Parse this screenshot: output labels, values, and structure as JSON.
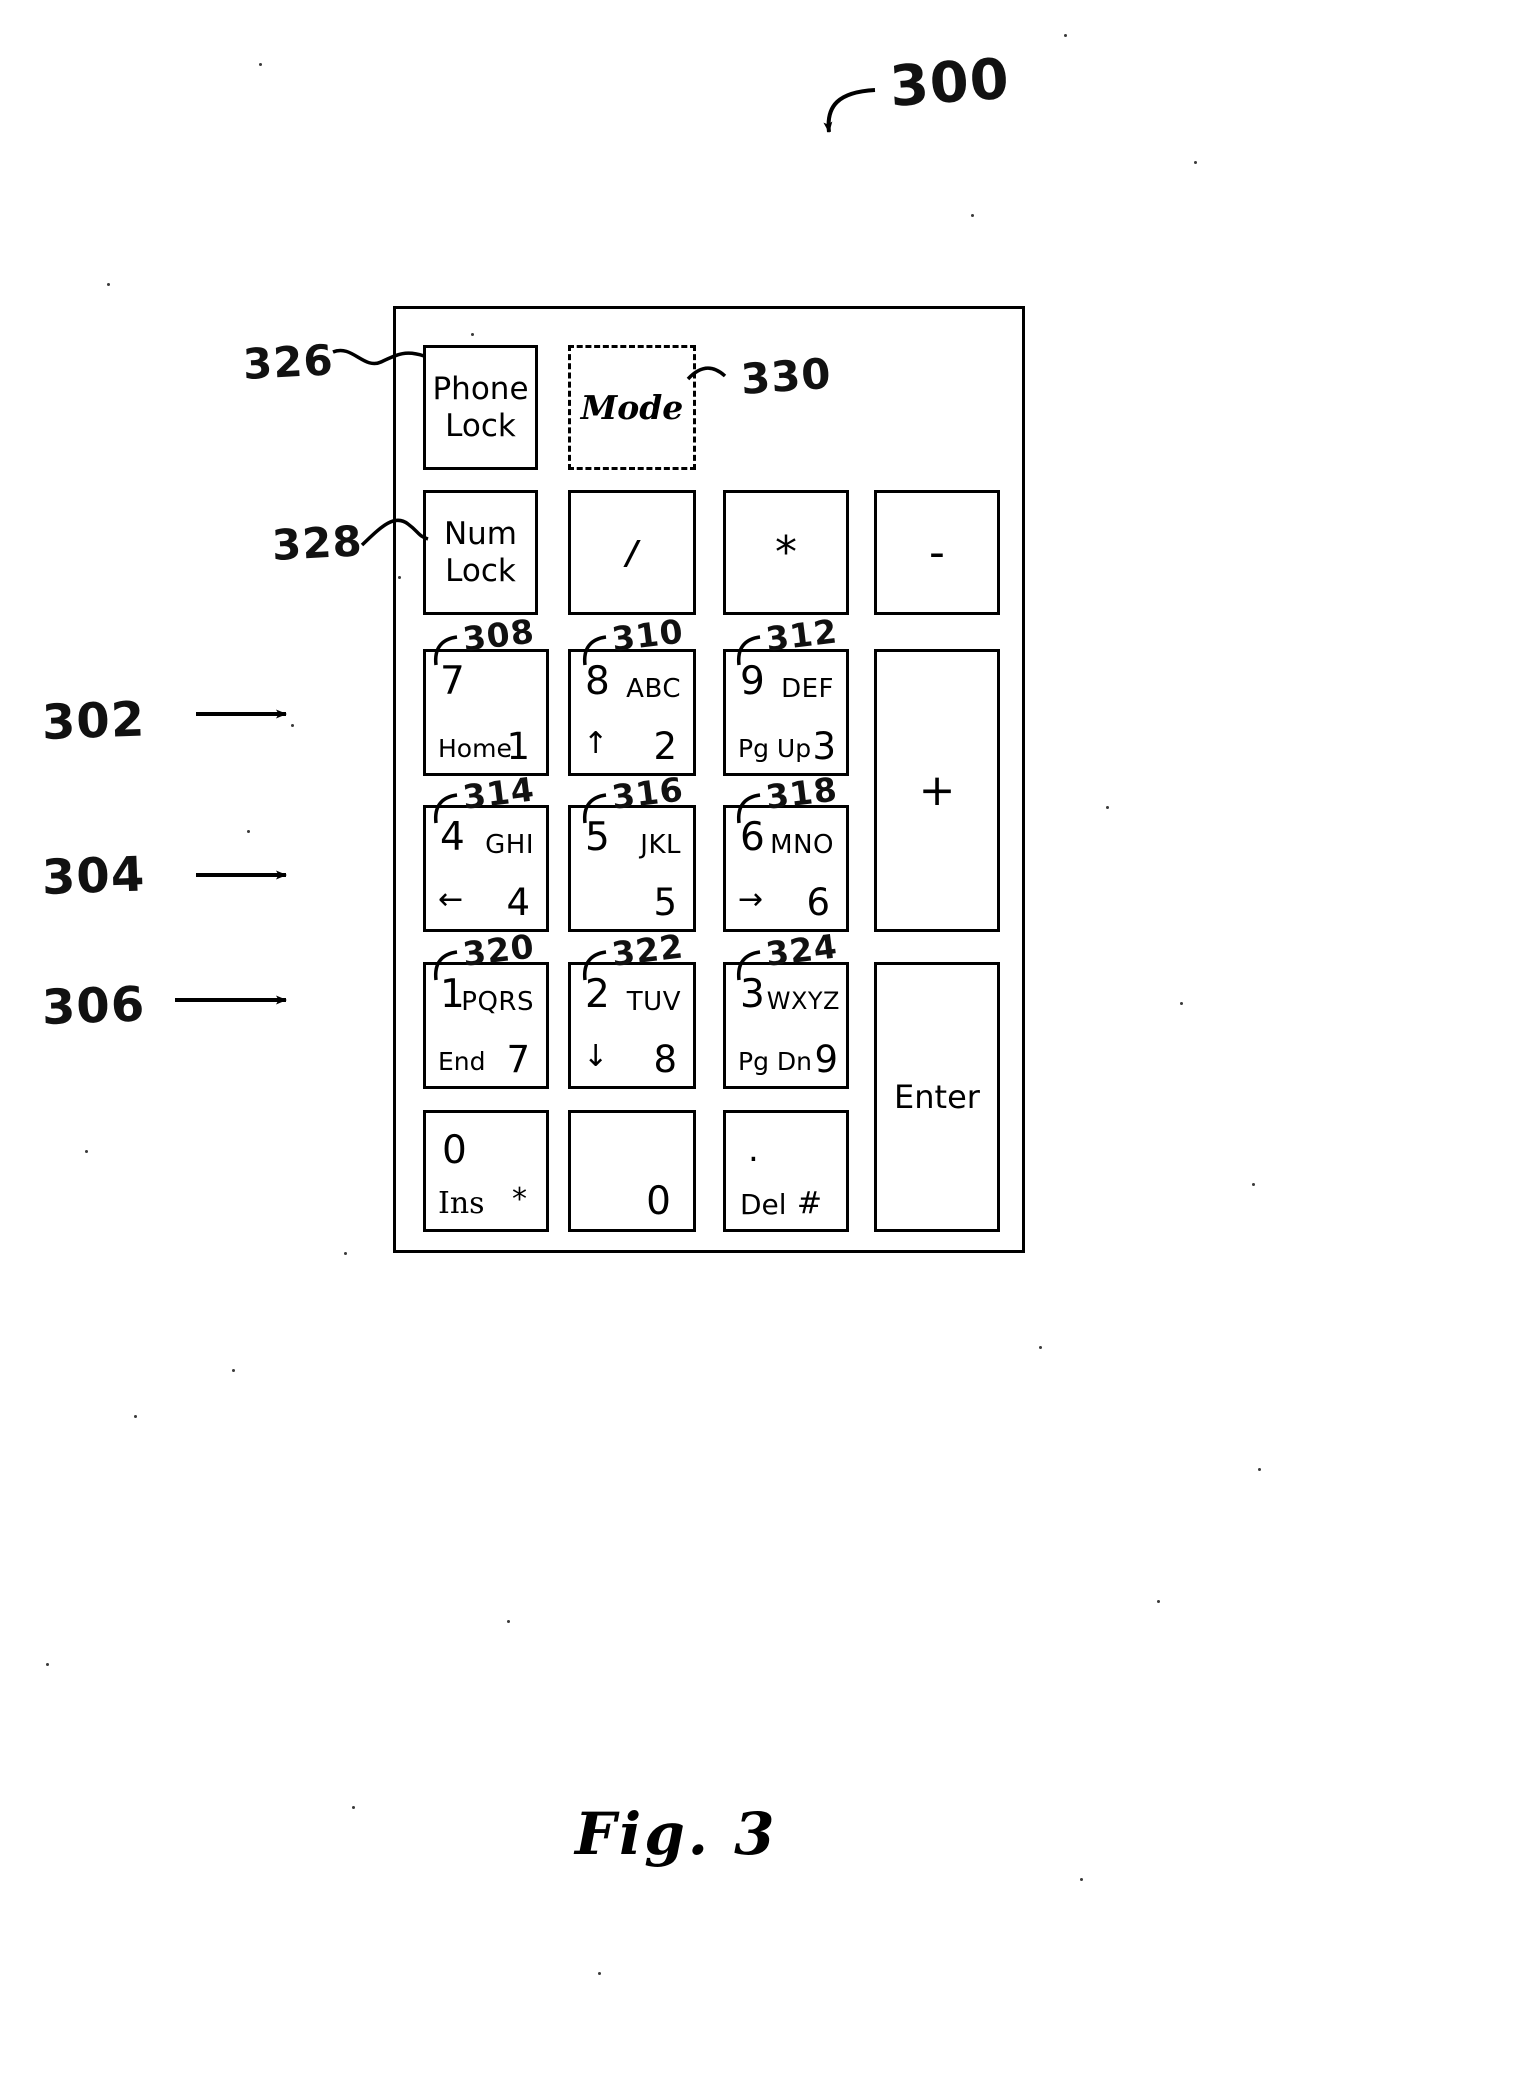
{
  "figure": {
    "caption": "Fig. 3",
    "top_reference": "300"
  },
  "device": {
    "label": "keypad-300"
  },
  "callouts": {
    "left": [
      {
        "id": "302",
        "text": "302"
      },
      {
        "id": "304",
        "text": "304"
      },
      {
        "id": "306",
        "text": "306"
      }
    ],
    "upper_left": [
      {
        "id": "326",
        "text": "326"
      },
      {
        "id": "328",
        "text": "328"
      }
    ],
    "mode": {
      "id": "330",
      "text": "330"
    },
    "keys": [
      {
        "id": "308",
        "text": "308"
      },
      {
        "id": "310",
        "text": "310"
      },
      {
        "id": "312",
        "text": "312"
      },
      {
        "id": "314",
        "text": "314"
      },
      {
        "id": "316",
        "text": "316"
      },
      {
        "id": "318",
        "text": "318"
      },
      {
        "id": "320",
        "text": "320"
      },
      {
        "id": "322",
        "text": "322"
      },
      {
        "id": "324",
        "text": "324"
      }
    ]
  },
  "keys": {
    "phone_lock": {
      "line1": "Phone",
      "line2": "Lock"
    },
    "mode": {
      "label": "Mode"
    },
    "num_lock": {
      "line1": "Num",
      "line2": "Lock"
    },
    "slash": {
      "label": "/"
    },
    "asterisk": {
      "label": "*"
    },
    "minus": {
      "label": "-"
    },
    "plus": {
      "label": "+"
    },
    "enter": {
      "label": "Enter"
    },
    "k7": {
      "num": "7",
      "alpha": "",
      "fn": "Home",
      "phone": "1"
    },
    "k8": {
      "num": "8",
      "alpha": "ABC",
      "fn": "↑",
      "phone": "2"
    },
    "k9": {
      "num": "9",
      "alpha": "DEF",
      "fn": "Pg Up",
      "phone": "3"
    },
    "k4": {
      "num": "4",
      "alpha": "GHI",
      "fn": "←",
      "phone": "4"
    },
    "k5": {
      "num": "5",
      "alpha": "JKL",
      "fn": "",
      "phone": "5"
    },
    "k6": {
      "num": "6",
      "alpha": "MNO",
      "fn": "→",
      "phone": "6"
    },
    "k1": {
      "num": "1",
      "alpha": "PQRS",
      "fn": "End",
      "phone": "7"
    },
    "k2": {
      "num": "2",
      "alpha": "TUV",
      "fn": "↓",
      "phone": "8"
    },
    "k3": {
      "num": "3",
      "alpha": "WXYZ",
      "fn": "Pg Dn",
      "phone": "9"
    },
    "k0_left": {
      "num": "0",
      "fn": "Ins",
      "phone": "*"
    },
    "k0_mid": {
      "phone": "0"
    },
    "kdot": {
      "num": ".",
      "fn": "Del",
      "phone": "#"
    }
  },
  "colors": {
    "ink": "#000000",
    "paper": "#ffffff"
  }
}
